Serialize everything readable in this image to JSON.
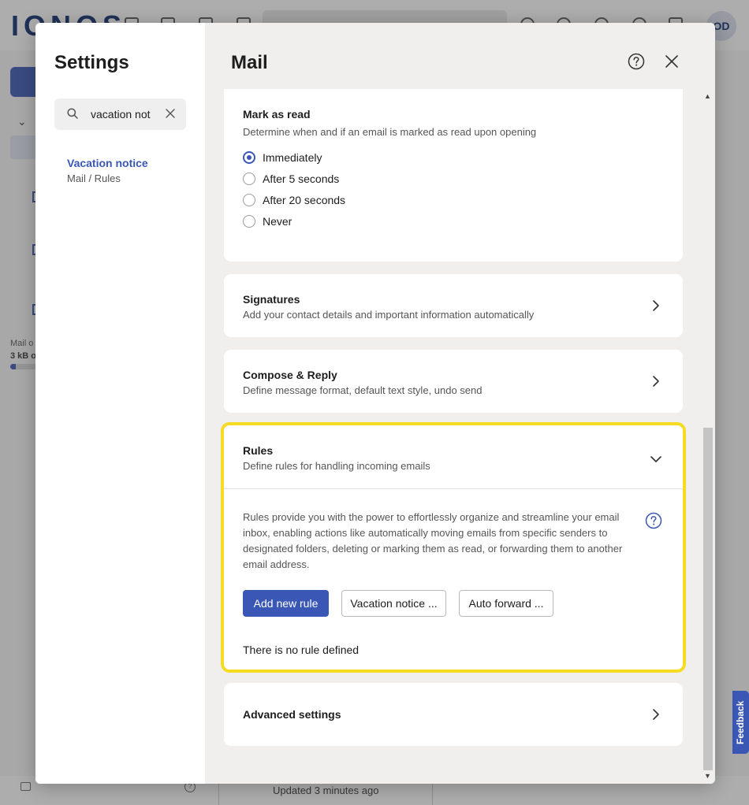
{
  "background": {
    "logo": "IONOS",
    "avatar_initials": "OD",
    "quota_label": "Mail o",
    "quota_size": "3 kB o",
    "quota_fraction": 0.2,
    "status": "Updated 3 minutes ago",
    "feedback_label": "Feedback"
  },
  "settings": {
    "title": "Settings",
    "search": {
      "value": "vacation not",
      "icon": "search-icon",
      "clear_icon": "close-icon"
    },
    "results": [
      {
        "title": "Vacation notice",
        "path": "Mail / Rules"
      }
    ]
  },
  "mail": {
    "title": "Mail",
    "mark_as_read": {
      "title": "Mark as read",
      "subtitle": "Determine when and if an email is marked as read upon opening",
      "options": [
        {
          "label": "Immediately",
          "selected": true
        },
        {
          "label": "After 5 seconds",
          "selected": false
        },
        {
          "label": "After 20 seconds",
          "selected": false
        },
        {
          "label": "Never",
          "selected": false
        }
      ]
    },
    "signatures": {
      "title": "Signatures",
      "subtitle": "Add your contact details and important information automatically"
    },
    "compose": {
      "title": "Compose & Reply",
      "subtitle": "Define message format, default text style, undo send"
    },
    "rules": {
      "title": "Rules",
      "subtitle": "Define rules for handling incoming emails",
      "description": "Rules provide you with the power to effortlessly organize and streamline your email inbox, enabling actions like automatically moving emails from specific senders to designated folders, deleting or marking them as read, or forwarding them to another email address.",
      "add_button": "Add new rule",
      "vacation_button": "Vacation notice ...",
      "forward_button": "Auto forward ...",
      "empty_text": "There is no rule defined",
      "highlight_color": "#f5dc22"
    },
    "advanced": {
      "title": "Advanced settings"
    }
  },
  "colors": {
    "accent": "#3a57b6",
    "panel_bg": "#f0efed"
  }
}
